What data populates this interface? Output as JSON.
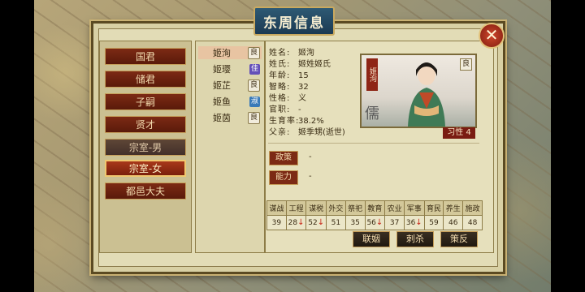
{
  "window": {
    "title": "东周信息",
    "close_icon": "close-icon"
  },
  "categories": [
    {
      "label": "国君",
      "state": "normal"
    },
    {
      "label": "储君",
      "state": "normal"
    },
    {
      "label": "子嗣",
      "state": "normal"
    },
    {
      "label": "贤才",
      "state": "normal"
    },
    {
      "label": "宗室-男",
      "state": "dim"
    },
    {
      "label": "宗室-女",
      "state": "active"
    },
    {
      "label": "都邑大夫",
      "state": "normal"
    }
  ],
  "members": [
    {
      "name": "姬洵",
      "grade": "良",
      "grade_color": "#f1ecdc",
      "selected": true
    },
    {
      "name": "姬璎",
      "grade": "佳",
      "grade_color": "#6450b8",
      "selected": false
    },
    {
      "name": "姬芷",
      "grade": "良",
      "grade_color": "#f1ecdc",
      "selected": false
    },
    {
      "name": "姬鱼",
      "grade": "淑",
      "grade_color": "#3a7ab8",
      "selected": false
    },
    {
      "name": "姬茵",
      "grade": "良",
      "grade_color": "#f1ecdc",
      "selected": false
    }
  ],
  "info": {
    "name_label": "姓名:",
    "name_value": "姬洵",
    "clan_label": "姓氏:",
    "clan_value": "姬姓姬氏",
    "age_label": "年龄:",
    "age_value": "15",
    "wit_label": "智略:",
    "wit_value": "32",
    "trait_label": "性格:",
    "trait_value": "义",
    "office_label": "官职:",
    "office_value": "-",
    "fert_label": "生育率:",
    "fert_value": "38.2%",
    "father_label": "父亲:",
    "father_value": "姬季甥(逝世)"
  },
  "portrait": {
    "name_tag": "姬洵",
    "grade": "良",
    "mark": "儒"
  },
  "xisheng": {
    "label": "习性 4"
  },
  "policy": {
    "label": "政策",
    "value": "-"
  },
  "ability": {
    "label": "能力",
    "value": "-"
  },
  "attributes": {
    "headers": [
      "谋战",
      "工程",
      "谋税",
      "外交",
      "祭祀",
      "教育",
      "农业",
      "军事",
      "育民",
      "养生",
      "施政"
    ],
    "values": [
      "39",
      "28",
      "52",
      "51",
      "35",
      "56",
      "37",
      "36",
      "59",
      "46",
      "48"
    ],
    "down_arrows": [
      false,
      true,
      true,
      false,
      false,
      true,
      false,
      true,
      false,
      false,
      false
    ]
  },
  "actions": {
    "marry": "联姻",
    "kill": "刺杀",
    "rebel": "策反"
  }
}
